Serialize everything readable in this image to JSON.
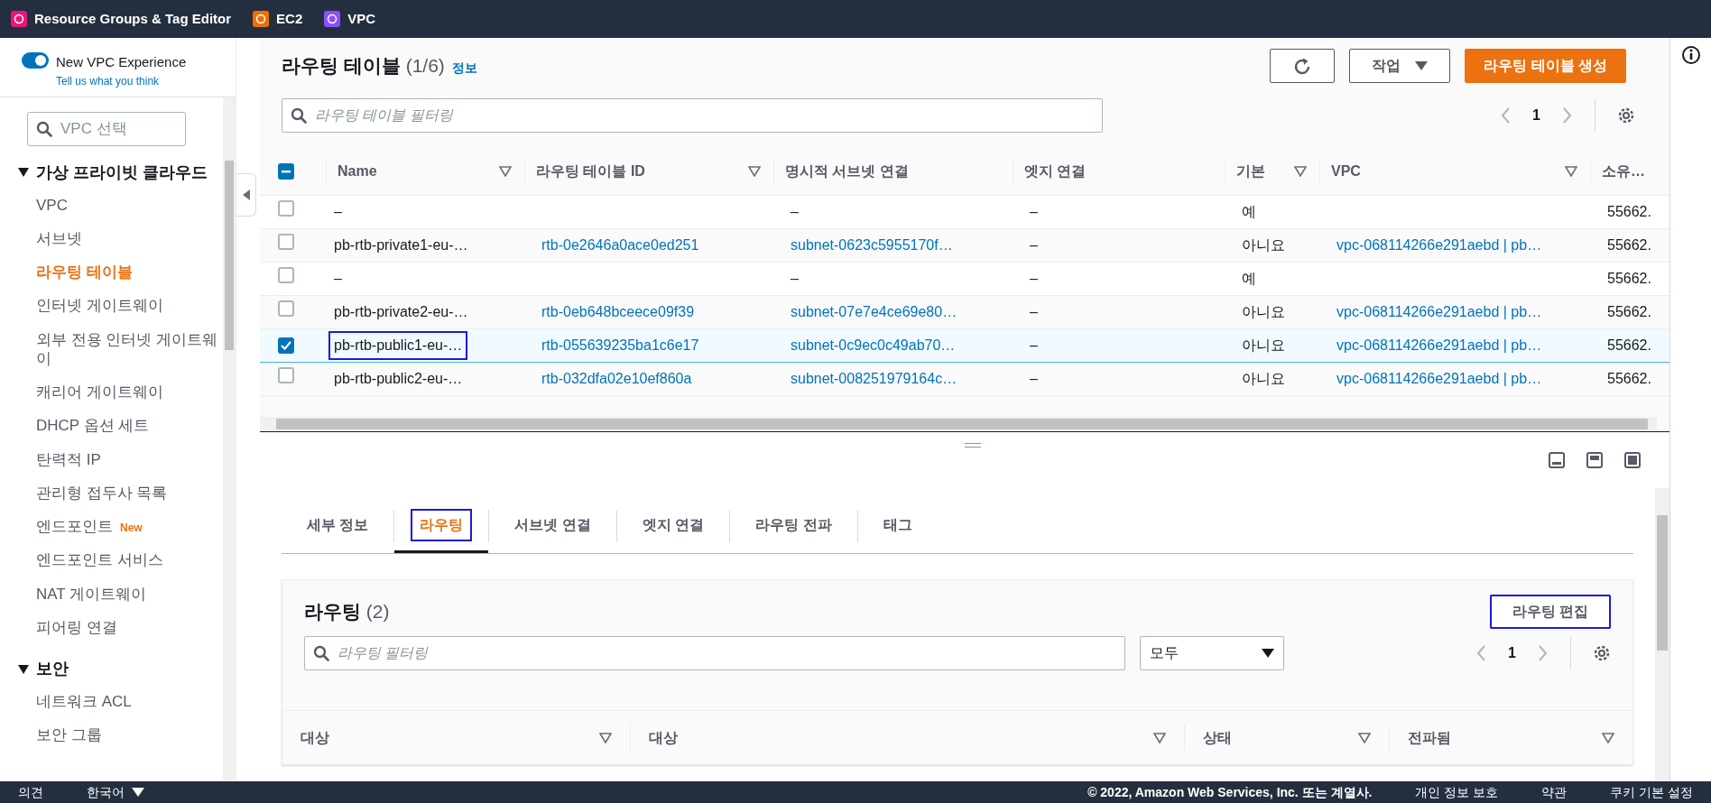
{
  "top_nav": [
    {
      "label": "Resource Groups & Tag Editor",
      "color": "#e7157b"
    },
    {
      "label": "EC2",
      "color": "#ed7100"
    },
    {
      "label": "VPC",
      "color": "#8c4fff"
    }
  ],
  "sidebar": {
    "toggle": {
      "label": "New VPC Experience",
      "on": true
    },
    "feedback_link": "Tell us what you think",
    "vpc_select": {
      "placeholder": "VPC 선택"
    },
    "sections": [
      {
        "title": "가상 프라이빗 클라우드",
        "expanded": true,
        "items": [
          {
            "label": "VPC",
            "selected": false
          },
          {
            "label": "서브넷",
            "selected": false
          },
          {
            "label": "라우팅 테이블",
            "selected": true
          },
          {
            "label": "인터넷 게이트웨이",
            "selected": false
          },
          {
            "label": "외부 전용 인터넷 게이트웨이",
            "selected": false
          },
          {
            "label": "캐리어 게이트웨이",
            "selected": false
          },
          {
            "label": "DHCP 옵션 세트",
            "selected": false
          },
          {
            "label": "탄력적 IP",
            "selected": false
          },
          {
            "label": "관리형 접두사 목록",
            "selected": false
          },
          {
            "label": "엔드포인트",
            "selected": false,
            "badge": "New"
          },
          {
            "label": "엔드포인트 서비스",
            "selected": false
          },
          {
            "label": "NAT 게이트웨이",
            "selected": false
          },
          {
            "label": "피어링 연결",
            "selected": false
          }
        ]
      },
      {
        "title": "보안",
        "expanded": true,
        "items": [
          {
            "label": "네트워크 ACL",
            "selected": false
          },
          {
            "label": "보안 그룹",
            "selected": false
          }
        ]
      }
    ]
  },
  "route_tables": {
    "title": "라우팅 테이블",
    "count": "(1/6)",
    "info_link": "정보",
    "actions_button": "작업",
    "create_button": "라우팅 테이블 생성",
    "filter": {
      "placeholder": "라우팅 테이블 필터링"
    },
    "page": "1",
    "select_all": {
      "indeterminate": true
    },
    "columns": [
      {
        "label": "Name",
        "sortable": true
      },
      {
        "label": "라우팅 테이블 ID",
        "sortable": true
      },
      {
        "label": "명시적 서브넷 연결",
        "sortable": false
      },
      {
        "label": "엣지 연결",
        "sortable": false
      },
      {
        "label": "기본",
        "sortable": true
      },
      {
        "label": "VPC",
        "sortable": true
      },
      {
        "label": "소유…"
      }
    ],
    "rows": [
      {
        "selected": false,
        "highlighted": false,
        "cells": [
          "–",
          null,
          "–",
          "–",
          "예",
          null,
          "55662."
        ]
      },
      {
        "selected": false,
        "highlighted": false,
        "cells": [
          "pb-rtb-private1-eu-…",
          "rtb-0e2646a0ace0ed251",
          "subnet-0623c5955170f…",
          "–",
          "아니요",
          "vpc-068114266e291aebd | pb…",
          "55662."
        ]
      },
      {
        "selected": false,
        "highlighted": false,
        "cells": [
          "–",
          null,
          "–",
          "–",
          "예",
          null,
          "55662."
        ]
      },
      {
        "selected": false,
        "highlighted": false,
        "cells": [
          "pb-rtb-private2-eu-…",
          "rtb-0eb648bceece09f39",
          "subnet-07e7e4ce69e80…",
          "–",
          "아니요",
          "vpc-068114266e291aebd | pb…",
          "55662."
        ]
      },
      {
        "selected": true,
        "highlighted": true,
        "cells": [
          "pb-rtb-public1-eu-…",
          "rtb-055639235ba1c6e17",
          "subnet-0c9ec0c49ab70…",
          "–",
          "아니요",
          "vpc-068114266e291aebd | pb…",
          "55662."
        ]
      },
      {
        "selected": false,
        "highlighted": false,
        "cells": [
          "pb-rtb-public2-eu-…",
          "rtb-032dfa02e10ef860a",
          "subnet-008251979164c…",
          "–",
          "아니요",
          "vpc-068114266e291aebd | pb…",
          "55662."
        ]
      }
    ]
  },
  "details": {
    "tabs": [
      {
        "label": "세부 정보",
        "selected": false,
        "highlighted": false
      },
      {
        "label": "라우팅",
        "selected": true,
        "highlighted": true
      },
      {
        "label": "서브넷 연결",
        "selected": false,
        "highlighted": false
      },
      {
        "label": "엣지 연결",
        "selected": false,
        "highlighted": false
      },
      {
        "label": "라우팅 전파",
        "selected": false,
        "highlighted": false
      },
      {
        "label": "태그",
        "selected": false,
        "highlighted": false
      }
    ],
    "routes": {
      "title": "라우팅",
      "count": "(2)",
      "edit_button": {
        "label": "라우팅 편집",
        "highlighted": true
      },
      "filter": {
        "placeholder": "라우팅 필터링"
      },
      "dropdown": "모두",
      "page": "1",
      "columns": [
        "대상",
        "대상",
        "상태",
        "전파됨"
      ]
    }
  },
  "footer": {
    "feedback": "의견",
    "language": "한국어",
    "copyright": "© 2022, Amazon Web Services, Inc. 또는 계열사.",
    "links": [
      "개인 정보 보호",
      "약관",
      "쿠키 기본 설정"
    ]
  }
}
